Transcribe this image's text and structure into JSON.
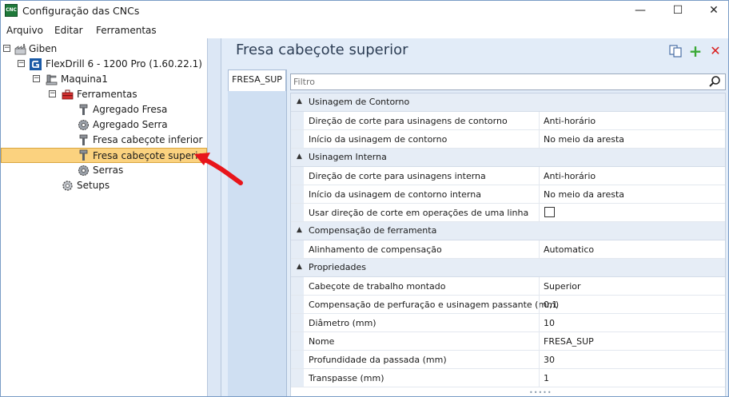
{
  "window": {
    "app_icon_text": "CNC",
    "title": "Configuração das CNCs",
    "minimize_glyph": "—",
    "maximize_glyph": "☐",
    "close_glyph": "✕"
  },
  "menu": {
    "items": [
      "Arquivo",
      "Editar",
      "Ferramentas"
    ]
  },
  "tree": {
    "root": "Giben",
    "machine_profile": "FlexDrill 6 - 1200 Pro (1.60.22.1)",
    "machine": "Maquina1",
    "tools_folder": "Ferramentas",
    "tools": [
      "Agregado Fresa",
      "Agregado Serra",
      "Fresa cabeçote inferior",
      "Fresa cabeçote superior",
      "Serras"
    ],
    "setups": "Setups",
    "selected": "Fresa cabeçote superior",
    "expander_glyph": "−"
  },
  "panel": {
    "title": "Fresa cabeçote superior",
    "tab": "FRESA_SUP",
    "add_glyph": "+",
    "delete_glyph": "✕",
    "filter_placeholder": "Filtro"
  },
  "grid": {
    "collapse_glyph": "▲",
    "grip": "•••••",
    "categories": [
      {
        "name": "Usinagem de Contorno",
        "properties": [
          {
            "name": "Direção de corte para usinagens de contorno",
            "value": "Anti-horário"
          },
          {
            "name": "Início da usinagem de contorno",
            "value": "No meio da aresta"
          }
        ]
      },
      {
        "name": "Usinagem Interna",
        "properties": [
          {
            "name": "Direção de corte para usinagens interna",
            "value": "Anti-horário"
          },
          {
            "name": "Início da usinagem de contorno interna",
            "value": "No meio da aresta"
          },
          {
            "name": "Usar direção de corte em operações de uma linha",
            "value": "",
            "checkbox": false
          }
        ]
      },
      {
        "name": "Compensação de ferramenta",
        "properties": [
          {
            "name": "Alinhamento de compensação",
            "value": "Automatico"
          }
        ]
      },
      {
        "name": "Propriedades",
        "properties": [
          {
            "name": "Cabeçote de trabalho montado",
            "value": "Superior"
          },
          {
            "name": "Compensação de perfuração e usinagem passante (mm)",
            "value": "0,1"
          },
          {
            "name": "Diâmetro (mm)",
            "value": "10"
          },
          {
            "name": "Nome",
            "value": "FRESA_SUP"
          },
          {
            "name": "Profundidade da passada (mm)",
            "value": "30"
          },
          {
            "name": "Transpasse (mm)",
            "value": "1"
          }
        ]
      }
    ]
  },
  "colors": {
    "selection_fill": "#fbd27f",
    "panel_bg": "#e2ecf8",
    "arrow": "#e8151b",
    "add_icon": "#3aa935",
    "delete_icon": "#d91e1e"
  }
}
